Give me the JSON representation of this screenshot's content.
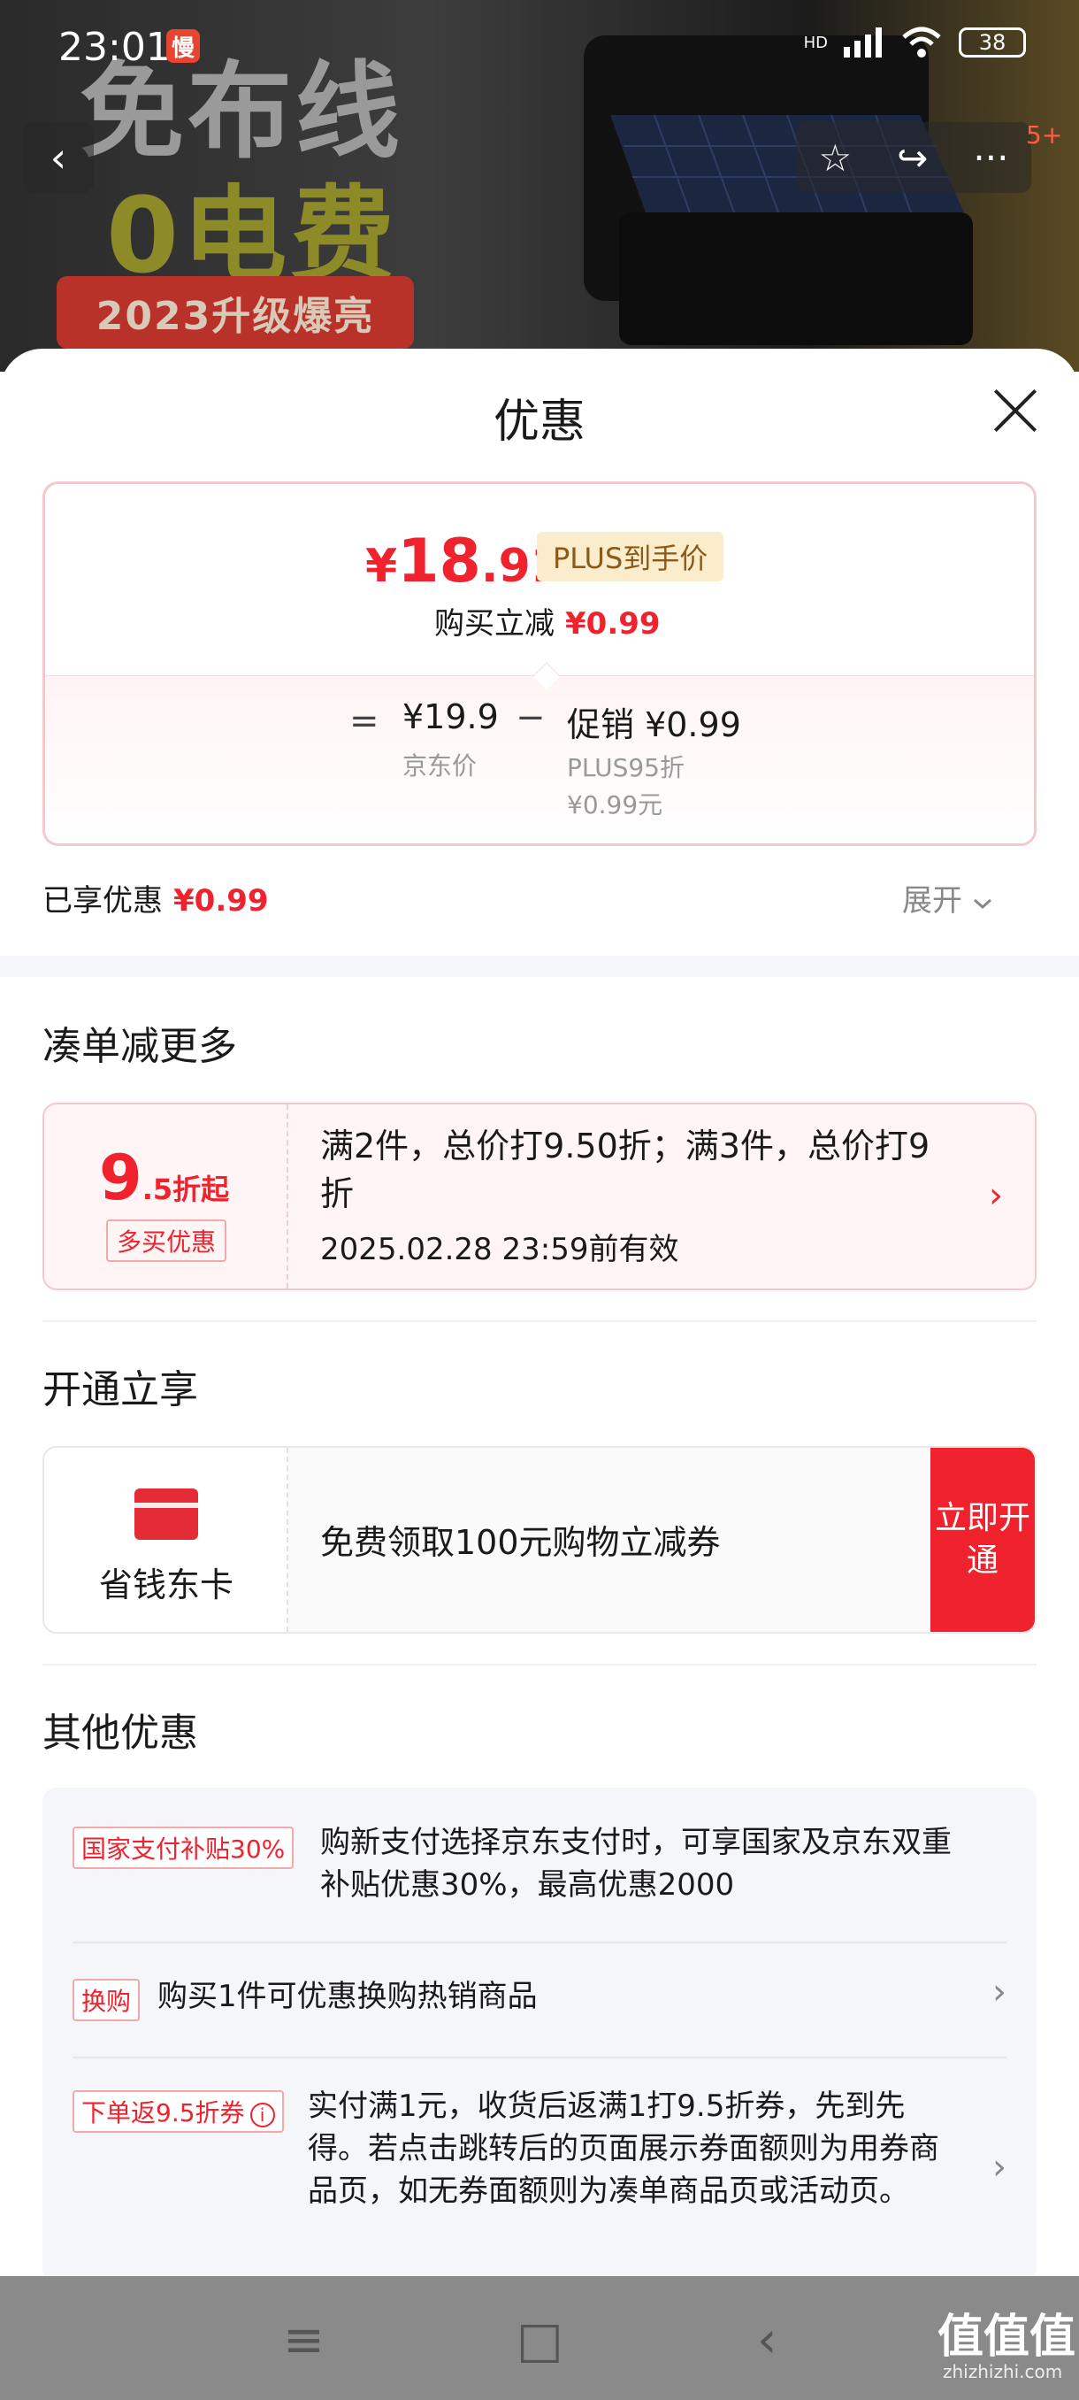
{
  "status_bar": {
    "time": "23:01",
    "badge": "慢",
    "network": "HD",
    "battery": "38"
  },
  "banner": {
    "line1": "免布线",
    "line2": "0电费",
    "tag": "2023升级爆亮",
    "message_count": "5+"
  },
  "nav": {
    "back": "‹",
    "star": "☆",
    "share": "↪",
    "more": "···"
  },
  "sheet": {
    "title": "优惠",
    "price": {
      "currency": "¥",
      "integer": "18",
      "decimal": ".91",
      "plus_label": "PLUS到手价",
      "reduce_label": "购买立减",
      "reduce_amount": "¥0.99",
      "equals": "=",
      "jd_price": "¥19.9",
      "jd_label": "京东价",
      "minus": "−",
      "promo": "促销 ¥0.99",
      "promo_detail": "PLUS95折",
      "promo_detail2": "¥0.99元"
    },
    "enjoyed_label": "已享优惠",
    "enjoyed_amount": "¥0.99",
    "expand": "展开",
    "combine": {
      "title": "凑单减更多",
      "discount_num": "9",
      "discount_suffix": ".5折起",
      "tag": "多买优惠",
      "desc": "满2件，总价打9.50折；满3件，总价打9折",
      "validity": "2025.02.28 23:59前有效",
      "arrow": "›"
    },
    "membership": {
      "title": "开通立享",
      "card_name": "省钱东卡",
      "desc": "免费领取100元购物立减券",
      "button": "立即开通"
    },
    "other": {
      "title": "其他优惠",
      "items": [
        {
          "tag": "国家支付补贴30%",
          "text": "购新支付选择京东支付时，可享国家及京东双重补贴优惠30%，最高优惠2000"
        },
        {
          "tag": "换购",
          "text": "购买1件可优惠换购热销商品"
        },
        {
          "tag": "下单返9.5折券",
          "text": "实付满1元，收货后返满1打9.5折券，先到先得。若点击跳转后的页面展示券面额则为用券商品页，如无券面额则为凑单商品页或活动页。"
        }
      ]
    }
  },
  "system_nav": {
    "menu": "≡",
    "home": "□",
    "back": "‹"
  },
  "watermark": {
    "main": "值值值",
    "sub": "zhizhizhi.com"
  },
  "colors": {
    "accent": "#f0222e",
    "plus_bg": "#fbeccc",
    "plus_text": "#8b5a19"
  }
}
